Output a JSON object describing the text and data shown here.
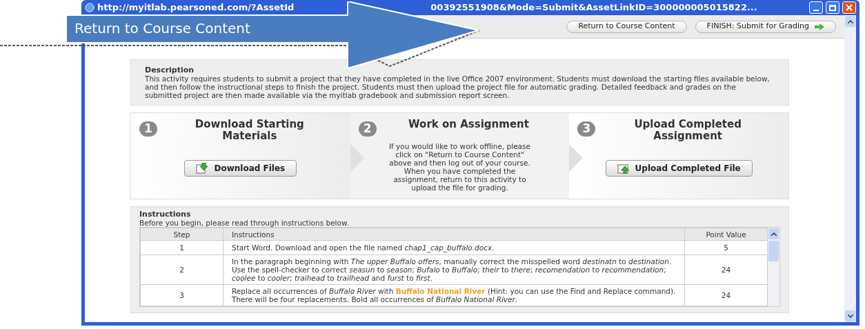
{
  "window": {
    "title_left": "http://myitlab.pearsoned.com/?AssetId",
    "title_right": "00392551908&Mode=Submit&AssetLinkID=300000005015822..."
  },
  "callout": {
    "label": "Return to Course Content"
  },
  "toolbar": {
    "buttons": [
      {
        "label": "Return to Course Content",
        "kind": "plain"
      },
      {
        "label": "FINISH: Submit for Grading",
        "kind": "submit"
      }
    ]
  },
  "description": {
    "heading": "Description",
    "text": "This activity requires students to submit a project that they have completed in the live Office 2007 environment. Students must download the starting files available below, and then follow the instructional steps to finish the project. Students must then upload the project file for automatic grading. Detailed feedback and grades on the submitted project are then made available via the myitlab gradebook and submission report screen."
  },
  "steps": [
    {
      "number": "1",
      "title": "Download Starting Materials",
      "kind": "download",
      "button": "Download Files"
    },
    {
      "number": "2",
      "title": "Work on Assignment",
      "kind": "note",
      "note": "If you would like to work offline, please click on \"Return to Course Content\" above and then log out of your course. When you have completed the assignment, return to this activity to upload the file for grading."
    },
    {
      "number": "3",
      "title": "Upload Completed Assignment",
      "kind": "upload",
      "button": "Upload Completed File"
    }
  ],
  "instructions": {
    "heading": "Instructions",
    "intro": "Before you begin, please read through instructions below.",
    "columns": [
      "Step",
      "Instructions",
      "Point Value"
    ],
    "rows": [
      {
        "step": "1",
        "text": "Start Word. Download and open the file named *chap1_cap_buffalo.docx*.",
        "points": "5"
      },
      {
        "step": "2",
        "text": "In the paragraph beginning with *The upper Buffalo offers*, manually correct the misspelled word *destinatn* to *destination*. Use the spell-checker to correct *seasun* to *season*; *Bufalo* to *Buffalo*; *their* to *there*; *recomendation* to *recommendation*; *coolee* to *cooler*; *traihead* to *trailhead* and *furst* to *first*.",
        "points": "24"
      },
      {
        "step": "3",
        "text": "Replace all occurrences of *Buffalo River* with **Buffalo National River** (Hint: you can use the Find and Replace command). There will be four replacements. Bold all occurrences of *Buffalo National River*.",
        "points": "24"
      }
    ]
  }
}
